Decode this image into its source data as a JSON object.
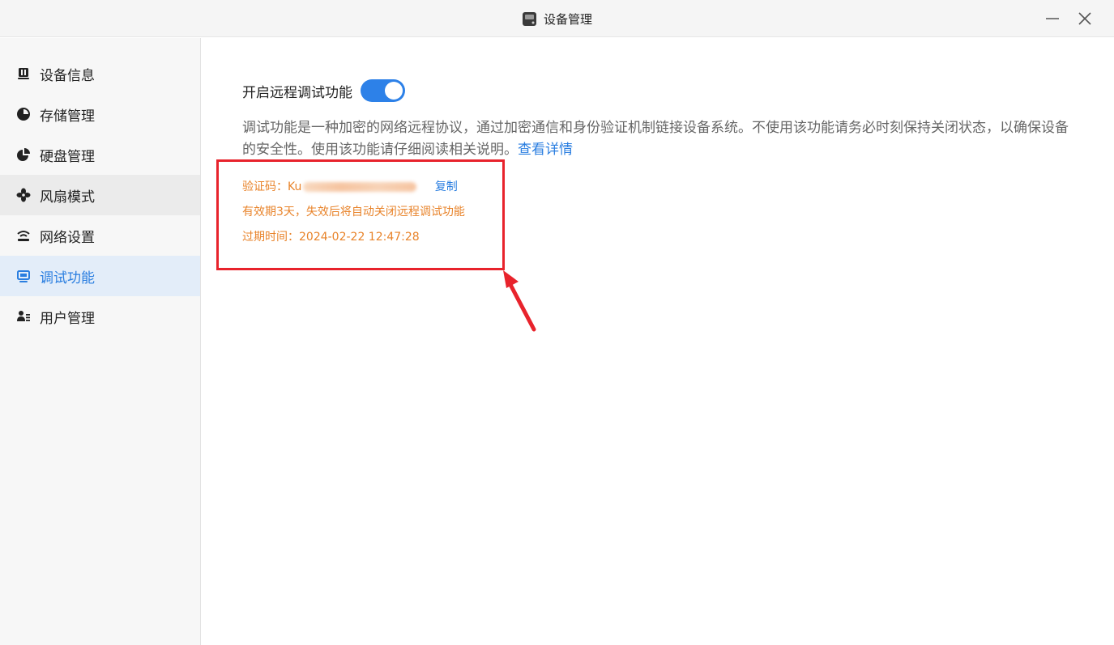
{
  "window": {
    "title": "设备管理",
    "minimize_icon": "minimize-icon",
    "close_icon": "close-icon"
  },
  "sidebar": {
    "items": [
      {
        "label": "设备信息",
        "icon": "device-info-icon"
      },
      {
        "label": "存储管理",
        "icon": "storage-pie-icon"
      },
      {
        "label": "硬盘管理",
        "icon": "disk-pie-icon"
      },
      {
        "label": "风扇模式",
        "icon": "fan-icon"
      },
      {
        "label": "网络设置",
        "icon": "network-icon"
      },
      {
        "label": "调试功能",
        "icon": "monitor-icon"
      },
      {
        "label": "用户管理",
        "icon": "users-icon"
      }
    ],
    "active_index": 5,
    "hover_index": 3
  },
  "main": {
    "toggle_label": "开启远程调试功能",
    "toggle_on": true,
    "description": "调试功能是一种加密的网络远程协议，通过加密通信和身份验证机制链接设备系统。不使用该功能请务必时刻保持关闭状态，以确保设备的安全性。使用该功能请仔细阅读相关说明。",
    "details_link": "查看详情",
    "code_label": "验证码：",
    "code_value": "Ku",
    "copy_label": "复制",
    "validity_text": "有效期3天，失效后将自动关闭远程调试功能",
    "expire_label": "过期时间：",
    "expire_value": "2024-02-22 12:47:28"
  },
  "colors": {
    "accent": "#2a7ee0",
    "toggle": "#2d81e8",
    "warning_text": "#e8832a",
    "annotation_red": "#e8232c"
  }
}
